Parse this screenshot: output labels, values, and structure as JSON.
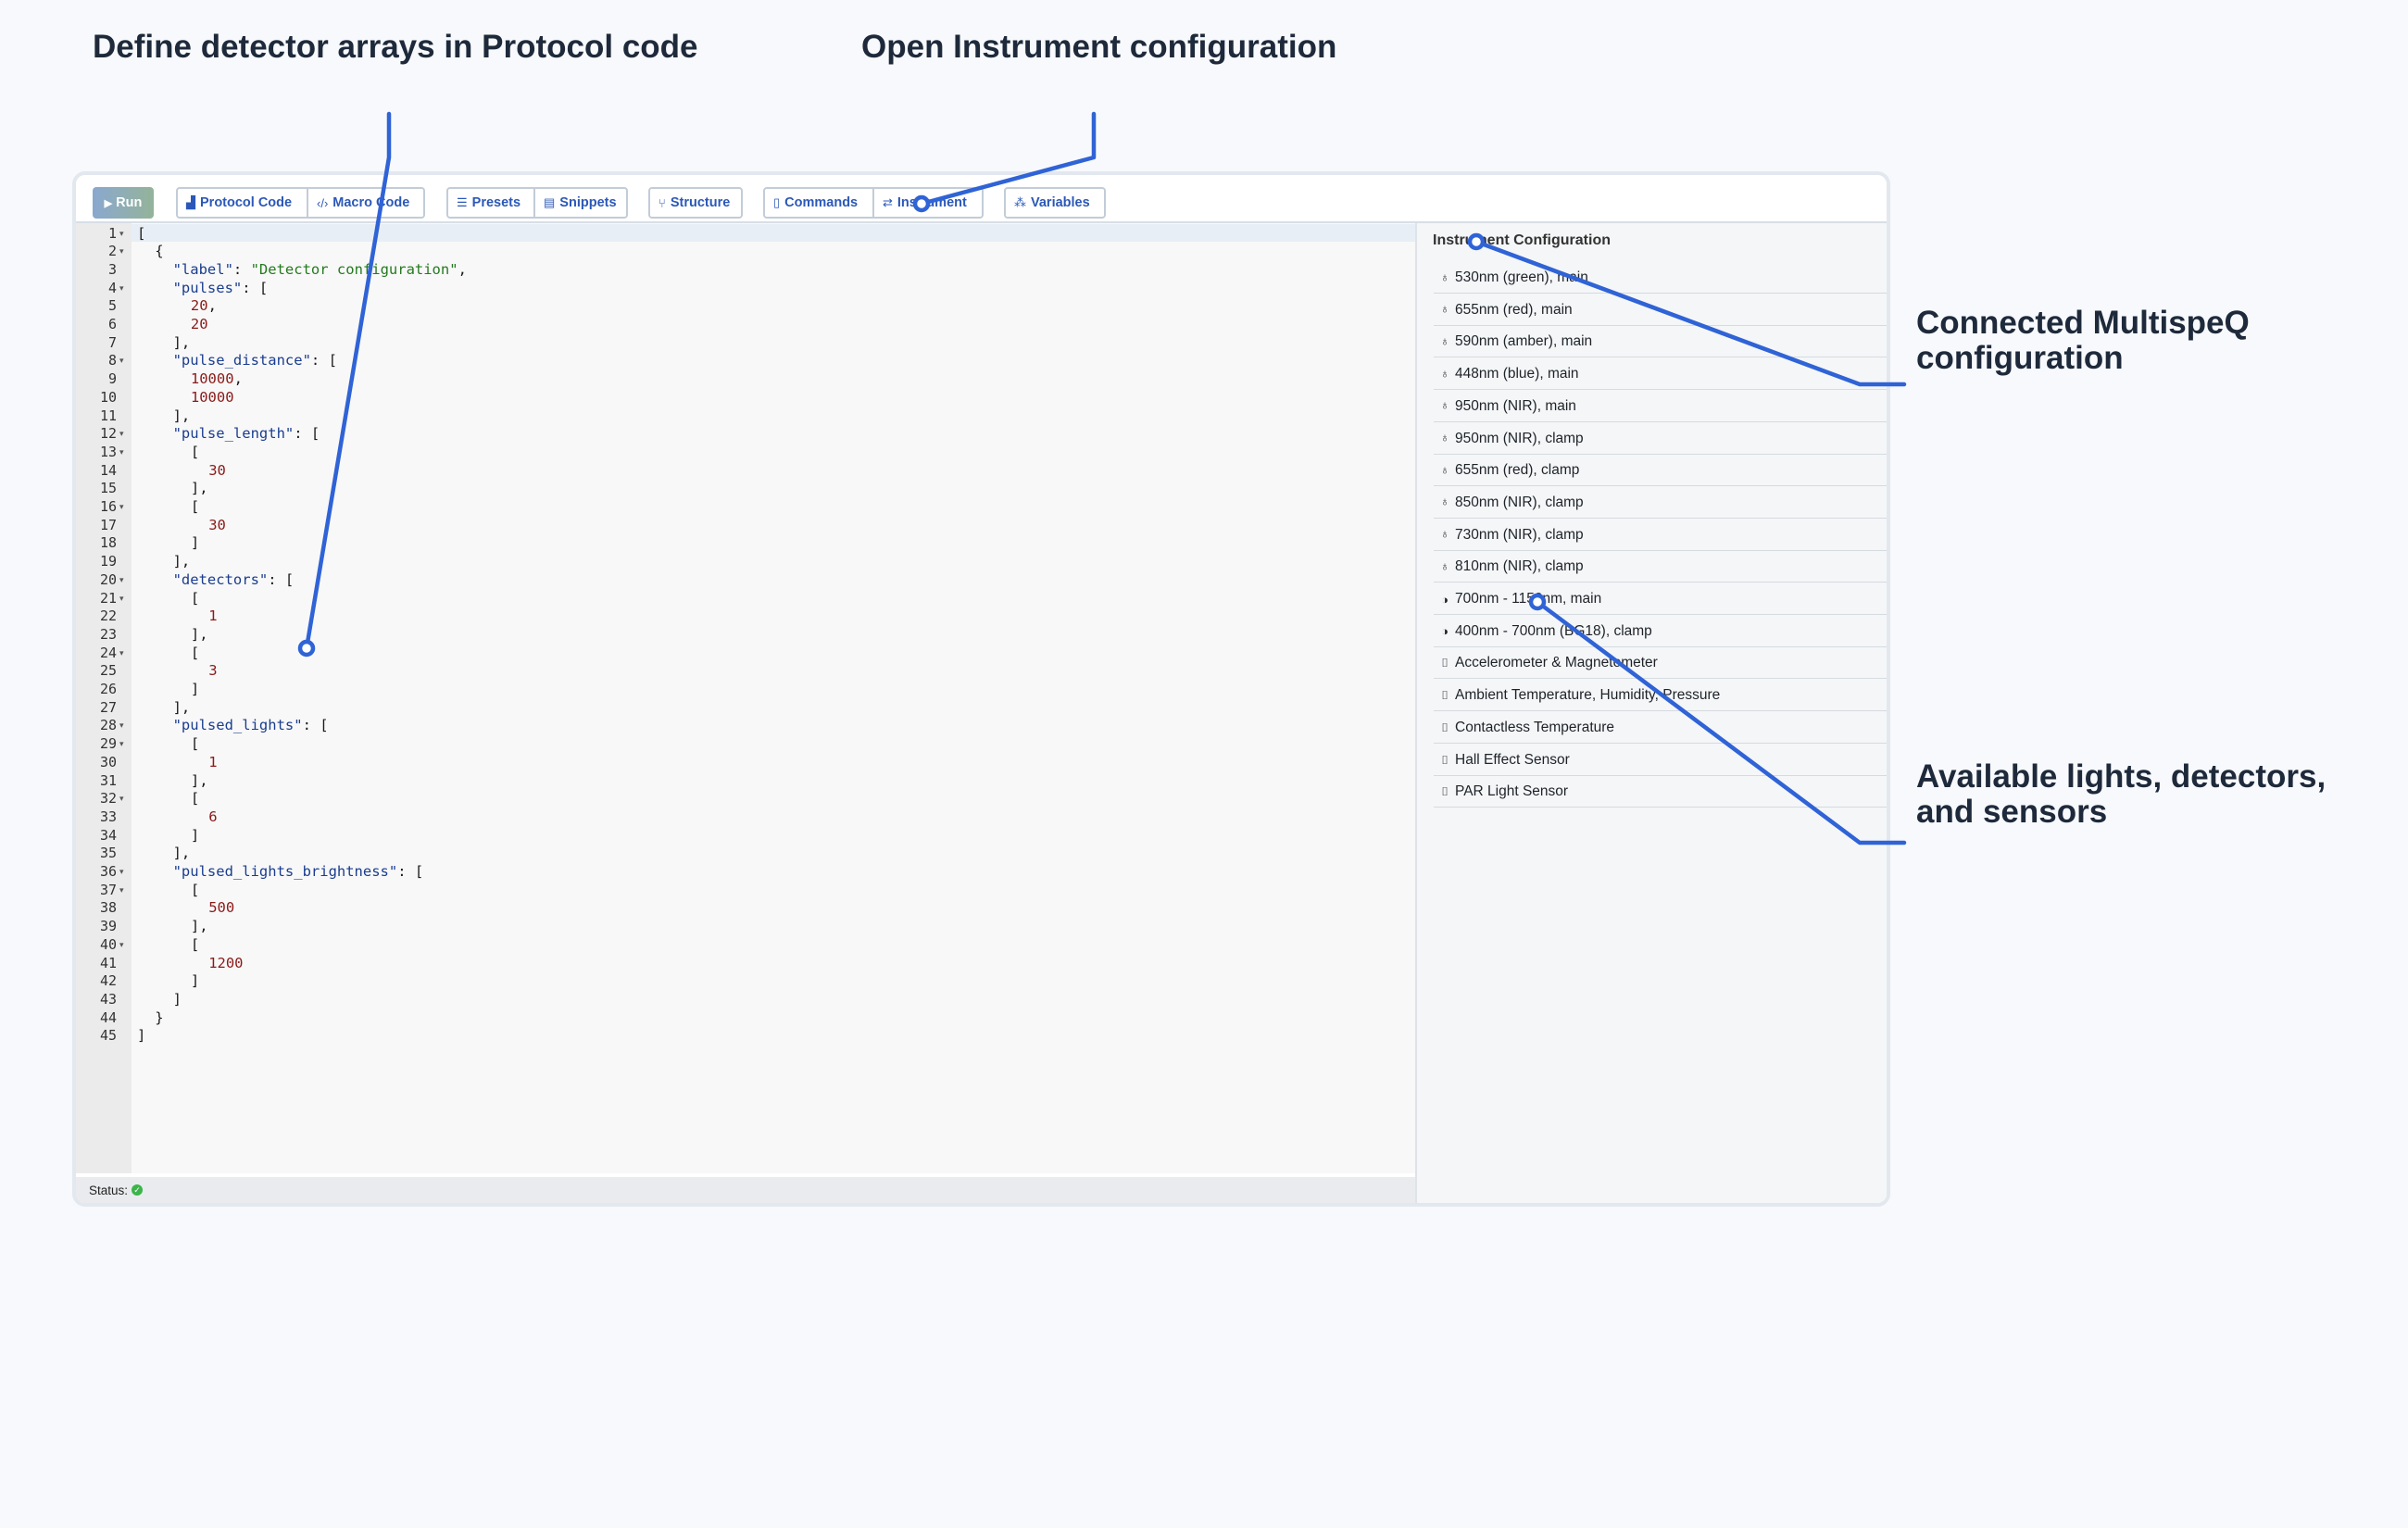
{
  "callouts": {
    "detectors": "Define detector arrays in Protocol code",
    "instrument": "Open Instrument configuration",
    "connected": "Connected MultispeQ\nconfiguration",
    "available": "Available lights, detectors,\nand sensors"
  },
  "toolbar": {
    "run": "Run",
    "protocol_code": "Protocol Code",
    "macro_code": "Macro Code",
    "presets": "Presets",
    "snippets": "Snippets",
    "structure": "Structure",
    "commands": "Commands",
    "instrument": "Instrument",
    "variables": "Variables"
  },
  "editor": {
    "lines": [
      {
        "n": "1",
        "fold": true,
        "indent": 0,
        "parts": [
          [
            "p",
            "["
          ]
        ]
      },
      {
        "n": "2",
        "fold": true,
        "indent": 1,
        "parts": [
          [
            "p",
            "{"
          ]
        ]
      },
      {
        "n": "3",
        "fold": false,
        "indent": 2,
        "parts": [
          [
            "k",
            "\"label\""
          ],
          [
            "p",
            ": "
          ],
          [
            "s",
            "\"Detector configuration\""
          ],
          [
            "p",
            ","
          ]
        ]
      },
      {
        "n": "4",
        "fold": true,
        "indent": 2,
        "parts": [
          [
            "k",
            "\"pulses\""
          ],
          [
            "p",
            ": ["
          ]
        ]
      },
      {
        "n": "5",
        "fold": false,
        "indent": 3,
        "parts": [
          [
            "n",
            "20"
          ],
          [
            "p",
            ","
          ]
        ]
      },
      {
        "n": "6",
        "fold": false,
        "indent": 3,
        "parts": [
          [
            "n",
            "20"
          ]
        ]
      },
      {
        "n": "7",
        "fold": false,
        "indent": 2,
        "parts": [
          [
            "p",
            "],"
          ]
        ]
      },
      {
        "n": "8",
        "fold": true,
        "indent": 2,
        "parts": [
          [
            "k",
            "\"pulse_distance\""
          ],
          [
            "p",
            ": ["
          ]
        ]
      },
      {
        "n": "9",
        "fold": false,
        "indent": 3,
        "parts": [
          [
            "n",
            "10000"
          ],
          [
            "p",
            ","
          ]
        ]
      },
      {
        "n": "10",
        "fold": false,
        "indent": 3,
        "parts": [
          [
            "n",
            "10000"
          ]
        ]
      },
      {
        "n": "11",
        "fold": false,
        "indent": 2,
        "parts": [
          [
            "p",
            "],"
          ]
        ]
      },
      {
        "n": "12",
        "fold": true,
        "indent": 2,
        "parts": [
          [
            "k",
            "\"pulse_length\""
          ],
          [
            "p",
            ": ["
          ]
        ]
      },
      {
        "n": "13",
        "fold": true,
        "indent": 3,
        "parts": [
          [
            "p",
            "["
          ]
        ]
      },
      {
        "n": "14",
        "fold": false,
        "indent": 4,
        "parts": [
          [
            "n",
            "30"
          ]
        ]
      },
      {
        "n": "15",
        "fold": false,
        "indent": 3,
        "parts": [
          [
            "p",
            "],"
          ]
        ]
      },
      {
        "n": "16",
        "fold": true,
        "indent": 3,
        "parts": [
          [
            "p",
            "["
          ]
        ]
      },
      {
        "n": "17",
        "fold": false,
        "indent": 4,
        "parts": [
          [
            "n",
            "30"
          ]
        ]
      },
      {
        "n": "18",
        "fold": false,
        "indent": 3,
        "parts": [
          [
            "p",
            "]"
          ]
        ]
      },
      {
        "n": "19",
        "fold": false,
        "indent": 2,
        "parts": [
          [
            "p",
            "],"
          ]
        ]
      },
      {
        "n": "20",
        "fold": true,
        "indent": 2,
        "parts": [
          [
            "k",
            "\"detectors\""
          ],
          [
            "p",
            ": ["
          ]
        ]
      },
      {
        "n": "21",
        "fold": true,
        "indent": 3,
        "parts": [
          [
            "p",
            "["
          ]
        ]
      },
      {
        "n": "22",
        "fold": false,
        "indent": 4,
        "parts": [
          [
            "n",
            "1"
          ]
        ]
      },
      {
        "n": "23",
        "fold": false,
        "indent": 3,
        "parts": [
          [
            "p",
            "],"
          ]
        ]
      },
      {
        "n": "24",
        "fold": true,
        "indent": 3,
        "parts": [
          [
            "p",
            "["
          ]
        ]
      },
      {
        "n": "25",
        "fold": false,
        "indent": 4,
        "parts": [
          [
            "n",
            "3"
          ]
        ]
      },
      {
        "n": "26",
        "fold": false,
        "indent": 3,
        "parts": [
          [
            "p",
            "]"
          ]
        ]
      },
      {
        "n": "27",
        "fold": false,
        "indent": 2,
        "parts": [
          [
            "p",
            "],"
          ]
        ]
      },
      {
        "n": "28",
        "fold": true,
        "indent": 2,
        "parts": [
          [
            "k",
            "\"pulsed_lights\""
          ],
          [
            "p",
            ": ["
          ]
        ]
      },
      {
        "n": "29",
        "fold": true,
        "indent": 3,
        "parts": [
          [
            "p",
            "["
          ]
        ]
      },
      {
        "n": "30",
        "fold": false,
        "indent": 4,
        "parts": [
          [
            "n",
            "1"
          ]
        ]
      },
      {
        "n": "31",
        "fold": false,
        "indent": 3,
        "parts": [
          [
            "p",
            "],"
          ]
        ]
      },
      {
        "n": "32",
        "fold": true,
        "indent": 3,
        "parts": [
          [
            "p",
            "["
          ]
        ]
      },
      {
        "n": "33",
        "fold": false,
        "indent": 4,
        "parts": [
          [
            "n",
            "6"
          ]
        ]
      },
      {
        "n": "34",
        "fold": false,
        "indent": 3,
        "parts": [
          [
            "p",
            "]"
          ]
        ]
      },
      {
        "n": "35",
        "fold": false,
        "indent": 2,
        "parts": [
          [
            "p",
            "],"
          ]
        ]
      },
      {
        "n": "36",
        "fold": true,
        "indent": 2,
        "parts": [
          [
            "k",
            "\"pulsed_lights_brightness\""
          ],
          [
            "p",
            ": ["
          ]
        ]
      },
      {
        "n": "37",
        "fold": true,
        "indent": 3,
        "parts": [
          [
            "p",
            "["
          ]
        ]
      },
      {
        "n": "38",
        "fold": false,
        "indent": 4,
        "parts": [
          [
            "n",
            "500"
          ]
        ]
      },
      {
        "n": "39",
        "fold": false,
        "indent": 3,
        "parts": [
          [
            "p",
            "],"
          ]
        ]
      },
      {
        "n": "40",
        "fold": true,
        "indent": 3,
        "parts": [
          [
            "p",
            "["
          ]
        ]
      },
      {
        "n": "41",
        "fold": false,
        "indent": 4,
        "parts": [
          [
            "n",
            "1200"
          ]
        ]
      },
      {
        "n": "42",
        "fold": false,
        "indent": 3,
        "parts": [
          [
            "p",
            "]"
          ]
        ]
      },
      {
        "n": "43",
        "fold": false,
        "indent": 2,
        "parts": [
          [
            "p",
            "]"
          ]
        ]
      },
      {
        "n": "44",
        "fold": false,
        "indent": 1,
        "parts": [
          [
            "p",
            "}"
          ]
        ]
      },
      {
        "n": "45",
        "fold": false,
        "indent": 0,
        "parts": [
          [
            "p",
            "]"
          ]
        ]
      }
    ]
  },
  "status": {
    "label": "Status:"
  },
  "instrument_panel": {
    "title": "Instrument Configuration",
    "items": [
      {
        "icon": "bulb-icon",
        "label": "530nm (green), main"
      },
      {
        "icon": "bulb-icon",
        "label": "655nm (red), main"
      },
      {
        "icon": "bulb-icon",
        "label": "590nm (amber), main"
      },
      {
        "icon": "bulb-icon",
        "label": "448nm (blue), main"
      },
      {
        "icon": "bulb-icon",
        "label": "950nm (NIR), main"
      },
      {
        "icon": "bulb-icon",
        "label": "950nm (NIR), clamp"
      },
      {
        "icon": "bulb-icon",
        "label": "655nm (red), clamp"
      },
      {
        "icon": "bulb-icon",
        "label": "850nm (NIR), clamp"
      },
      {
        "icon": "bulb-icon",
        "label": "730nm (NIR), clamp"
      },
      {
        "icon": "bulb-icon",
        "label": "810nm (NIR), clamp"
      },
      {
        "icon": "detector-icon",
        "label": "700nm - 1150nm, main"
      },
      {
        "icon": "detector-icon",
        "label": "400nm - 700nm (BG18), clamp"
      },
      {
        "icon": "thermometer-icon",
        "label": "Accelerometer & Magnetometer"
      },
      {
        "icon": "thermometer-icon",
        "label": "Ambient Temperature, Humidity, Pressure"
      },
      {
        "icon": "thermometer-icon",
        "label": "Contactless Temperature"
      },
      {
        "icon": "thermometer-icon",
        "label": "Hall Effect Sensor"
      },
      {
        "icon": "thermometer-icon",
        "label": "PAR Light Sensor"
      }
    ]
  },
  "colors": {
    "callout_line": "#2f63d6",
    "accent": "#2b58b8",
    "status_ok": "#3bb54a"
  }
}
